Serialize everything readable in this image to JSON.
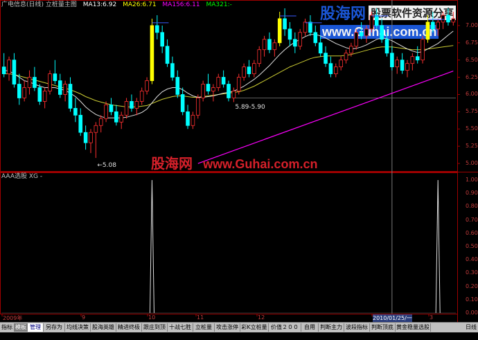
{
  "main_panel": {
    "title": "广电信息(日线) 立桩量主图",
    "ma": [
      {
        "label": "MA13:6.92",
        "color": "#ffffff"
      },
      {
        "label": "MA26:6.71",
        "color": "#ffff00"
      },
      {
        "label": "MA156:6.11",
        "color": "#ff00ff"
      },
      {
        "label": "MA321:-",
        "color": "#00ff00"
      }
    ],
    "annotations": [
      {
        "text": "5.89-5.90",
        "index": 45,
        "price": 5.9
      },
      {
        "text": "5.08",
        "index": 18,
        "price": 5.08
      }
    ],
    "yticks": [
      "7.00",
      "6.75",
      "6.50",
      "6.25",
      "6.00",
      "5.75",
      "5.50",
      "5.25",
      "5.00"
    ]
  },
  "indicator_panel": {
    "title": "AAA选股  XG -",
    "yticks": [
      "1.00",
      "0.90",
      "0.80",
      "0.70",
      "0.60",
      "0.50",
      "0.40",
      "0.30",
      "0.20",
      "0.10",
      "0.00"
    ]
  },
  "date_axis": {
    "labels": [
      "2009年",
      "9",
      "10",
      "11",
      "12",
      "2010/01/25/一",
      "3"
    ]
  },
  "tabs": [
    {
      "label": "指标"
    },
    {
      "label": "模板"
    },
    {
      "label": "管理"
    },
    {
      "label": "另存为"
    },
    {
      "label": "均线决策"
    },
    {
      "label": "股海英雄"
    },
    {
      "label": "精进终极"
    },
    {
      "label": "跟庄到顶"
    },
    {
      "label": "十战七胜"
    },
    {
      "label": "立桩量"
    },
    {
      "label": "攻击涨停"
    },
    {
      "label": "彩K立桩量"
    },
    {
      "label": "价值２００万"
    },
    {
      "label": "自用"
    },
    {
      "label": "判断主力"
    },
    {
      "label": "波段指标"
    },
    {
      "label": "判断顶底"
    },
    {
      "label": "黄金稳量选股"
    }
  ],
  "timeframe": "日线",
  "watermark": {
    "logo": "股海网",
    "slogan": "股票软件资源分享",
    "url": "www.Guhai.com.cn",
    "mid_logo": "股海网",
    "mid_url": "www.Guhai.com.cn"
  },
  "chart_data": {
    "type": "candlestick",
    "price_range": [
      4.9,
      7.25
    ],
    "ohlc": [
      [
        6.4,
        6.6,
        6.25,
        6.3
      ],
      [
        6.3,
        6.55,
        6.2,
        6.5
      ],
      [
        6.5,
        6.6,
        6.1,
        6.15
      ],
      [
        6.15,
        6.3,
        5.85,
        5.95
      ],
      [
        5.95,
        6.2,
        5.9,
        6.1
      ],
      [
        6.1,
        6.35,
        6.0,
        6.25
      ],
      [
        6.25,
        6.4,
        6.05,
        6.1
      ],
      [
        6.1,
        6.15,
        5.85,
        5.9
      ],
      [
        5.9,
        6.1,
        5.8,
        6.05
      ],
      [
        6.05,
        6.35,
        6.0,
        6.3
      ],
      [
        6.3,
        6.5,
        6.15,
        6.2
      ],
      [
        6.2,
        6.3,
        5.95,
        6.0
      ],
      [
        6.0,
        6.2,
        5.9,
        6.15
      ],
      [
        6.15,
        6.25,
        5.75,
        5.8
      ],
      [
        5.8,
        5.95,
        5.6,
        5.7
      ],
      [
        5.7,
        5.8,
        5.4,
        5.45
      ],
      [
        5.45,
        5.55,
        5.2,
        5.3
      ],
      [
        5.3,
        5.5,
        5.15,
        5.45
      ],
      [
        5.45,
        5.6,
        5.08,
        5.55
      ],
      [
        5.55,
        5.7,
        5.45,
        5.65
      ],
      [
        5.65,
        5.9,
        5.6,
        5.85
      ],
      [
        5.85,
        5.95,
        5.7,
        5.75
      ],
      [
        5.75,
        5.85,
        5.55,
        5.6
      ],
      [
        5.6,
        5.75,
        5.5,
        5.7
      ],
      [
        5.7,
        5.95,
        5.65,
        5.9
      ],
      [
        5.9,
        6.0,
        5.75,
        5.8
      ],
      [
        5.8,
        5.95,
        5.7,
        5.9
      ],
      [
        5.9,
        6.1,
        5.85,
        6.05
      ],
      [
        6.05,
        6.25,
        6.0,
        6.2
      ],
      [
        6.2,
        7.1,
        6.15,
        7.0
      ],
      [
        7.0,
        7.15,
        6.8,
        6.9
      ],
      [
        6.9,
        7.0,
        6.6,
        6.7
      ],
      [
        6.7,
        6.8,
        6.4,
        6.45
      ],
      [
        6.45,
        6.55,
        6.2,
        6.25
      ],
      [
        6.25,
        6.35,
        5.95,
        6.0
      ],
      [
        6.0,
        6.1,
        5.7,
        5.75
      ],
      [
        5.75,
        5.85,
        5.5,
        5.55
      ],
      [
        5.55,
        5.75,
        5.5,
        5.7
      ],
      [
        5.7,
        6.0,
        5.65,
        5.95
      ],
      [
        5.95,
        6.2,
        5.9,
        6.15
      ],
      [
        6.15,
        6.3,
        6.0,
        6.05
      ],
      [
        6.05,
        6.15,
        5.9,
        6.1
      ],
      [
        6.1,
        6.3,
        6.05,
        6.25
      ],
      [
        6.25,
        6.35,
        6.1,
        6.15
      ],
      [
        6.15,
        6.2,
        5.9,
        5.95
      ],
      [
        5.95,
        6.1,
        5.89,
        6.05
      ],
      [
        6.05,
        6.3,
        6.0,
        6.25
      ],
      [
        6.25,
        6.45,
        6.2,
        6.4
      ],
      [
        6.4,
        6.5,
        6.25,
        6.3
      ],
      [
        6.3,
        6.5,
        6.25,
        6.45
      ],
      [
        6.45,
        6.7,
        6.4,
        6.65
      ],
      [
        6.65,
        6.85,
        6.55,
        6.8
      ],
      [
        6.8,
        6.9,
        6.6,
        6.65
      ],
      [
        6.65,
        6.8,
        6.55,
        6.75
      ],
      [
        6.75,
        7.2,
        6.7,
        7.1
      ],
      [
        7.1,
        7.25,
        6.85,
        6.95
      ],
      [
        6.95,
        7.05,
        6.7,
        6.8
      ],
      [
        6.8,
        6.9,
        6.6,
        6.7
      ],
      [
        6.7,
        6.95,
        6.65,
        6.9
      ],
      [
        6.9,
        7.1,
        6.85,
        7.05
      ],
      [
        7.05,
        7.15,
        6.85,
        6.9
      ],
      [
        6.9,
        7.0,
        6.7,
        6.75
      ],
      [
        6.75,
        6.85,
        6.55,
        6.6
      ],
      [
        6.6,
        6.7,
        6.4,
        6.45
      ],
      [
        6.45,
        6.55,
        6.25,
        6.3
      ],
      [
        6.3,
        6.45,
        6.25,
        6.4
      ],
      [
        6.4,
        6.55,
        6.35,
        6.5
      ],
      [
        6.5,
        6.65,
        6.45,
        6.6
      ],
      [
        6.6,
        6.75,
        6.55,
        6.7
      ],
      [
        6.7,
        6.95,
        6.65,
        6.9
      ],
      [
        6.9,
        7.05,
        6.8,
        6.85
      ],
      [
        6.85,
        7.0,
        6.75,
        6.95
      ],
      [
        6.95,
        7.2,
        6.9,
        7.15
      ],
      [
        7.15,
        7.25,
        6.95,
        7.0
      ],
      [
        7.0,
        7.1,
        6.75,
        6.8
      ],
      [
        6.8,
        6.9,
        6.55,
        6.6
      ],
      [
        6.6,
        6.7,
        6.35,
        6.4
      ],
      [
        6.4,
        6.55,
        6.3,
        6.5
      ],
      [
        6.5,
        6.6,
        6.3,
        6.35
      ],
      [
        6.35,
        6.5,
        6.25,
        6.45
      ],
      [
        6.45,
        6.6,
        6.35,
        6.55
      ],
      [
        6.55,
        6.7,
        6.45,
        6.5
      ],
      [
        6.5,
        6.85,
        6.45,
        6.8
      ],
      [
        6.8,
        7.15,
        6.75,
        7.05
      ],
      [
        7.05,
        7.2,
        6.9,
        6.95
      ],
      [
        6.95,
        7.1,
        6.85,
        7.05
      ],
      [
        7.05,
        7.2,
        6.95,
        7.15
      ],
      [
        7.15,
        7.25,
        7.0,
        7.05
      ],
      [
        7.05,
        7.2,
        7.0,
        7.1
      ]
    ],
    "ma13": [
      6.35,
      6.34,
      6.3,
      6.25,
      6.2,
      6.18,
      6.15,
      6.12,
      6.1,
      6.1,
      6.1,
      6.08,
      6.06,
      6.02,
      5.97,
      5.9,
      5.82,
      5.76,
      5.71,
      5.68,
      5.66,
      5.66,
      5.66,
      5.66,
      5.67,
      5.69,
      5.71,
      5.74,
      5.79,
      5.88,
      5.97,
      6.04,
      6.08,
      6.1,
      6.1,
      6.07,
      6.02,
      5.98,
      5.96,
      5.96,
      5.97,
      5.98,
      6.0,
      6.02,
      6.03,
      6.05,
      6.08,
      6.12,
      6.17,
      6.22,
      6.28,
      6.35,
      6.42,
      6.5,
      6.58,
      6.65,
      6.71,
      6.76,
      6.8,
      6.84,
      6.87,
      6.87,
      6.85,
      6.82,
      6.78,
      6.74,
      6.71,
      6.68,
      6.66,
      6.67,
      6.69,
      6.72,
      6.76,
      6.8,
      6.82,
      6.81,
      6.78,
      6.74,
      6.7,
      6.66,
      6.63,
      6.61,
      6.62,
      6.66,
      6.7,
      6.74,
      6.8,
      6.86,
      6.92
    ],
    "ma26": [
      6.3,
      6.3,
      6.29,
      6.27,
      6.25,
      6.23,
      6.21,
      6.19,
      6.17,
      6.15,
      6.13,
      6.11,
      6.09,
      6.07,
      6.04,
      6.01,
      5.97,
      5.94,
      5.91,
      5.89,
      5.87,
      5.85,
      5.84,
      5.83,
      5.82,
      5.82,
      5.82,
      5.83,
      5.84,
      5.87,
      5.9,
      5.93,
      5.95,
      5.97,
      5.98,
      5.98,
      5.97,
      5.96,
      5.96,
      5.97,
      5.98,
      5.99,
      6.0,
      6.01,
      6.02,
      6.03,
      6.04,
      6.06,
      6.09,
      6.12,
      6.16,
      6.2,
      6.24,
      6.28,
      6.32,
      6.36,
      6.4,
      6.43,
      6.46,
      6.49,
      6.52,
      6.54,
      6.55,
      6.56,
      6.56,
      6.56,
      6.56,
      6.57,
      6.58,
      6.6,
      6.62,
      6.64,
      6.66,
      6.68,
      6.69,
      6.69,
      6.69,
      6.68,
      6.67,
      6.66,
      6.65,
      6.65,
      6.65,
      6.66,
      6.67,
      6.68,
      6.69,
      6.7,
      6.71
    ],
    "ma156": {
      "start_index": 38,
      "start": 5.0,
      "end": 6.34
    },
    "signals": [
      {
        "index": 29,
        "value": 1.0
      },
      {
        "index": 85,
        "value": 1.0
      }
    ],
    "highlight_bars": [
      29,
      54,
      83
    ],
    "marker_line_index": 76
  }
}
